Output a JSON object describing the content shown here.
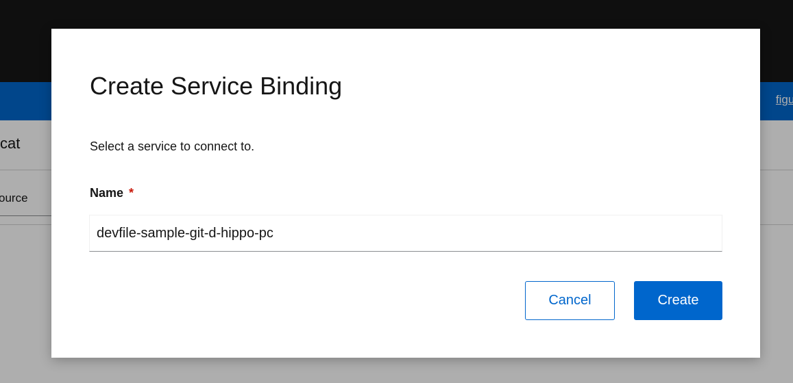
{
  "background": {
    "banner_link": "figur",
    "page_title": "plicat",
    "select_value": "ource"
  },
  "modal": {
    "title": "Create Service Binding",
    "description": "Select a service to connect to.",
    "name_field": {
      "label": "Name",
      "required_mark": "*",
      "value": "devfile-sample-git-d-hippo-pc"
    },
    "cancel_label": "Cancel",
    "create_label": "Create"
  },
  "colors": {
    "masthead": "#151515",
    "banner": "#0066cc",
    "primary": "#0066cc",
    "required": "#c9190b"
  }
}
